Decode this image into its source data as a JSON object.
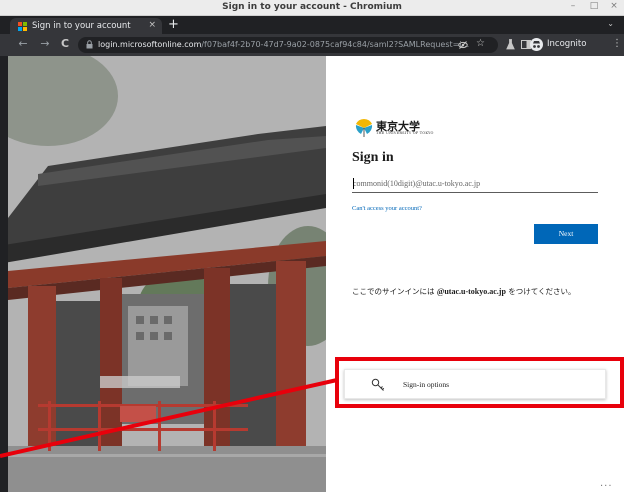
{
  "window": {
    "title": "Sign in to your account - Chromium",
    "controls": {
      "minimize": "–",
      "maximize": "□",
      "close": "×"
    }
  },
  "tab": {
    "title": "Sign in to your account",
    "close": "×",
    "new_tab": "+",
    "tab_menu": "⌄"
  },
  "toolbar": {
    "back": "←",
    "forward": "→",
    "reload": "C",
    "url_host": "login.microsoftonline.com",
    "url_path": "/f07baf4f-2b70-47d7-9a02-0875caf94c84/saml2?SAMLRequest=j...",
    "incognito_label": "Incognito",
    "kebab": "⋮"
  },
  "signin": {
    "org_name_jp": "東京大学",
    "org_name_en": "THE UNIVERSITY OF TOKYO",
    "heading": "Sign in",
    "input_placeholder": "commonid(10digit)@utac.u-tokyo.ac.jp",
    "cant_access": "Can't access your account?",
    "next_button": "Next",
    "note_before": "ここでのサインインには ",
    "note_bold": "@utac.u-tokyo.ac.jp",
    "note_after": " をつけてください。",
    "sign_in_options": "Sign-in options",
    "footer_ellipsis": "..."
  },
  "colors": {
    "accent": "#0067b8",
    "highlight": "#e8000b",
    "chrome_dark": "#202124",
    "chrome_toolbar": "#35363a"
  }
}
